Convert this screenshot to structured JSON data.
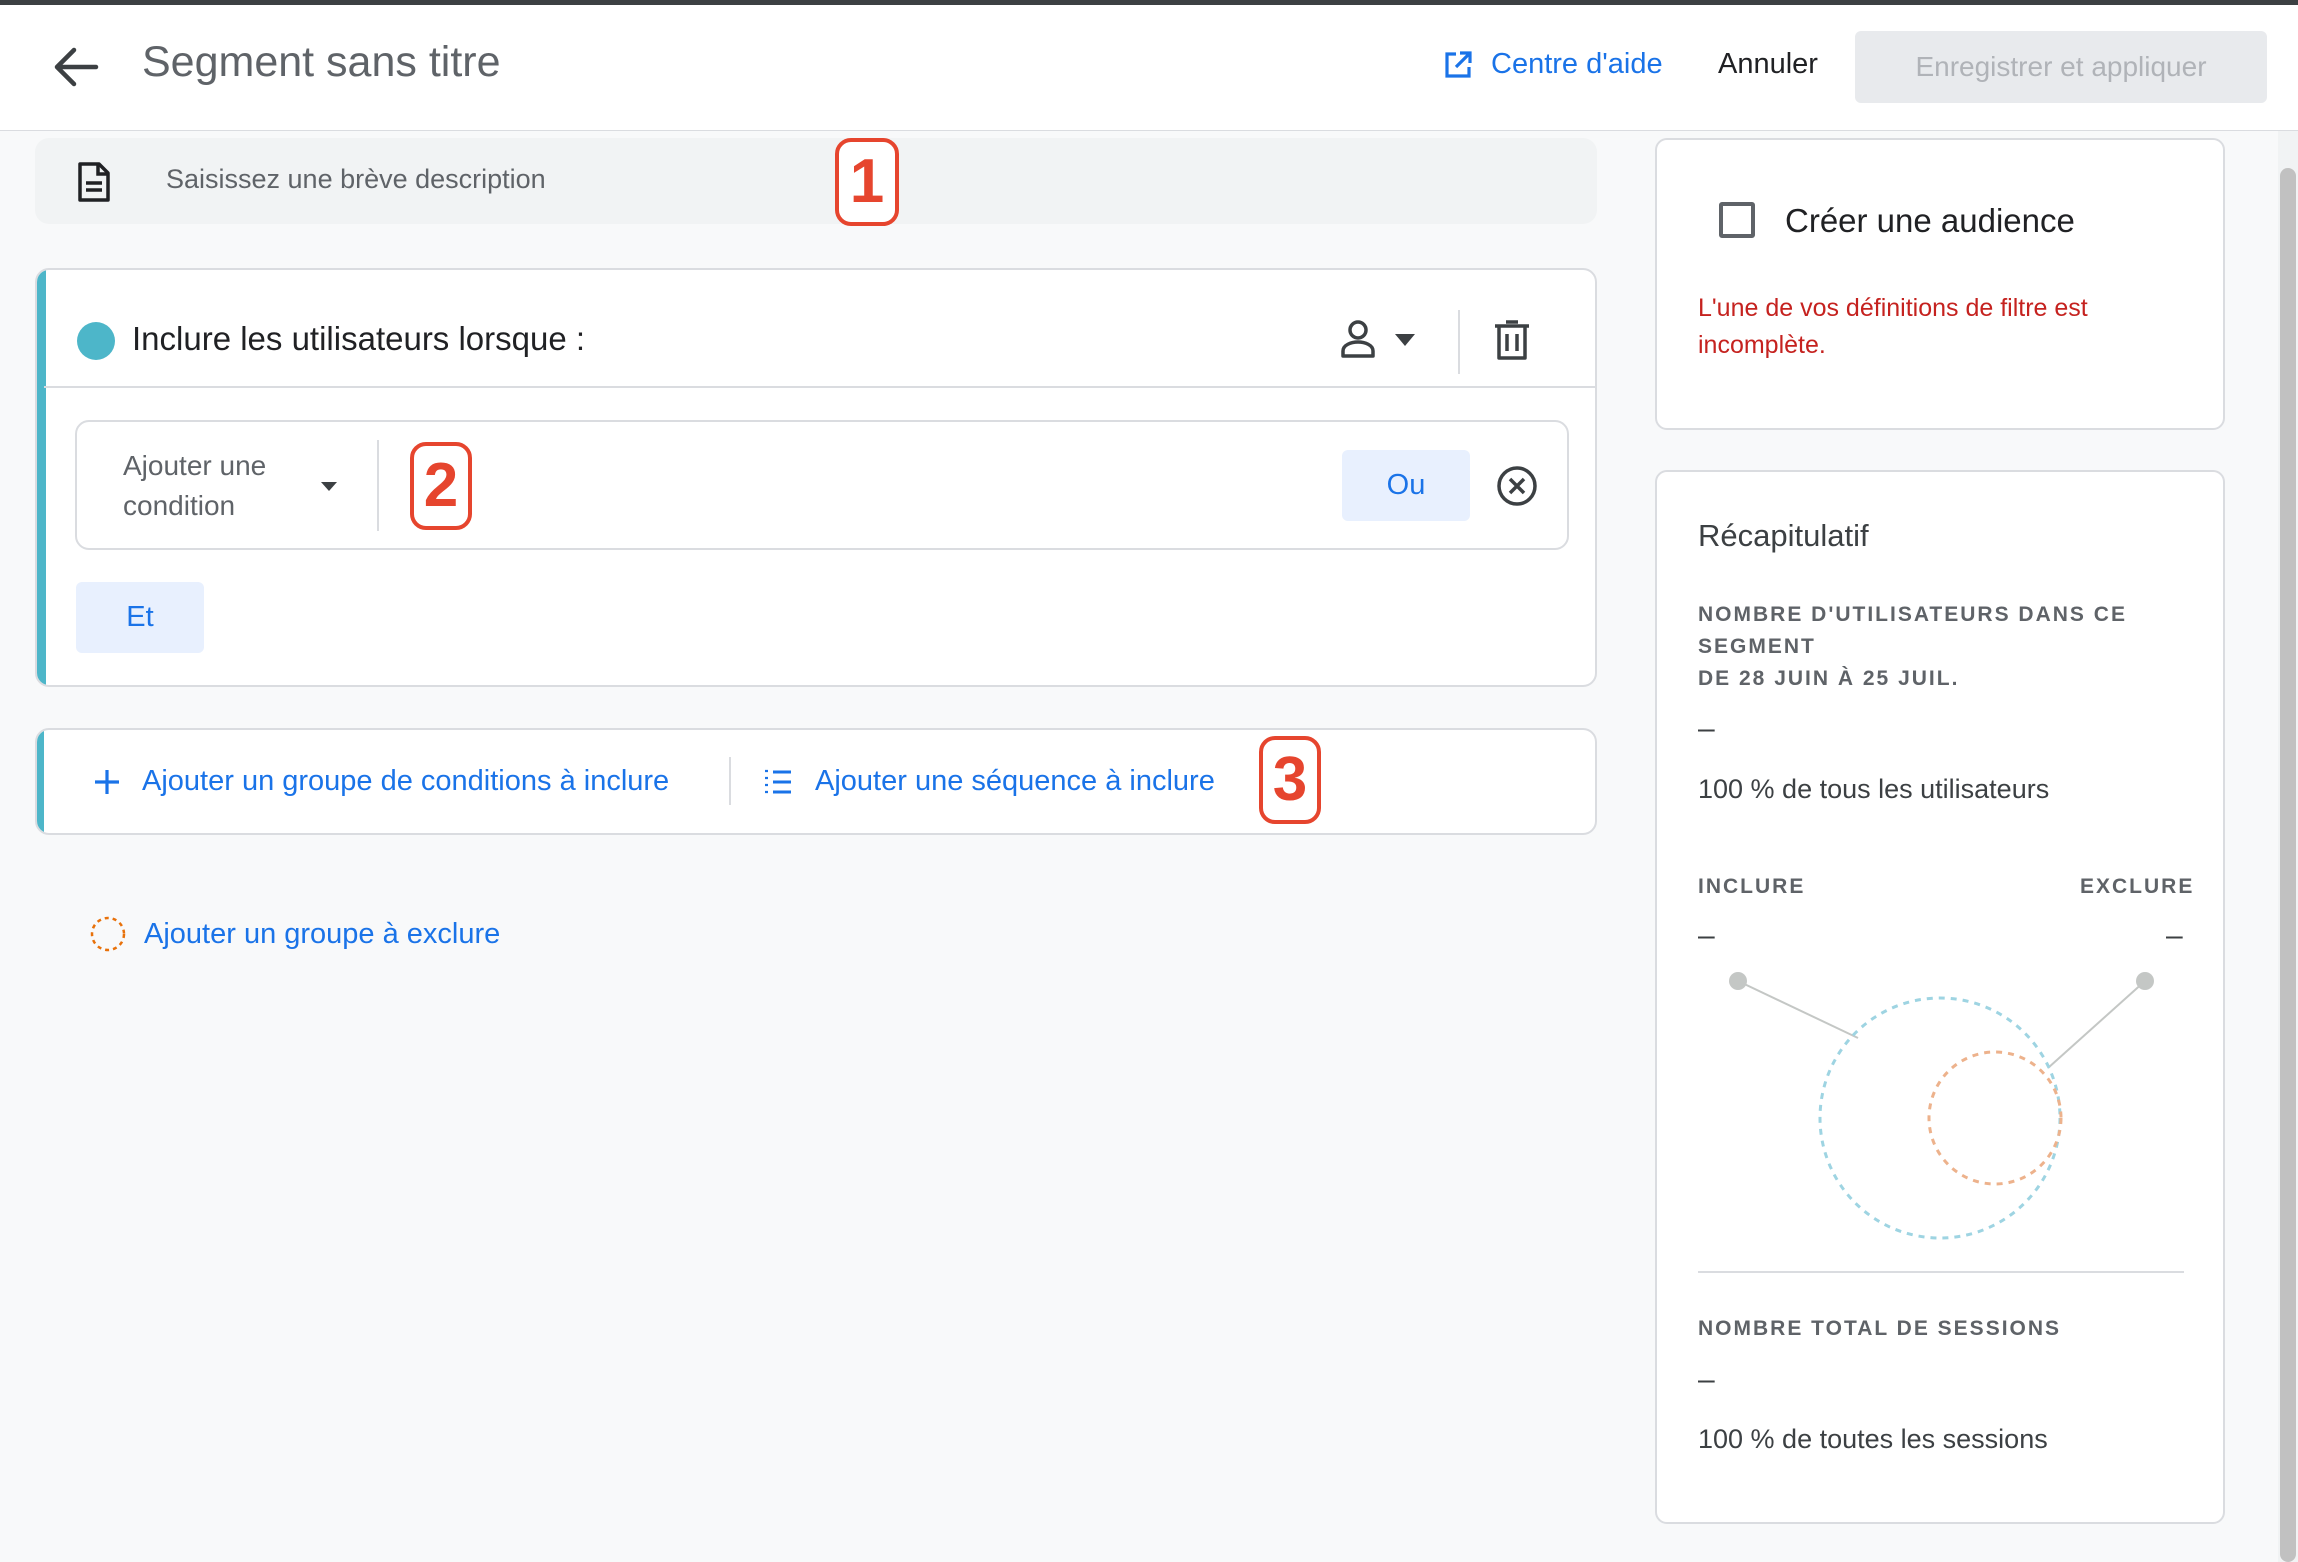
{
  "header": {
    "title": "Segment sans titre",
    "help_label": "Centre d'aide",
    "cancel_label": "Annuler",
    "save_label": "Enregistrer et appliquer"
  },
  "description": {
    "placeholder": "Saisissez une brève description"
  },
  "callouts": [
    "1",
    "2",
    "3"
  ],
  "include_group": {
    "title": "Inclure les utilisateurs lorsque :",
    "condition_placeholder_line1": "Ajouter une",
    "condition_placeholder_line2": "condition",
    "or_label": "Ou",
    "and_label": "Et"
  },
  "actions": {
    "add_condition_group": "Ajouter un groupe de conditions à inclure",
    "add_sequence": "Ajouter une séquence à inclure",
    "add_exclude_group": "Ajouter un groupe à exclure"
  },
  "audience": {
    "label": "Créer une audience",
    "error": "L'une de vos définitions de filtre est incomplète."
  },
  "summary": {
    "title": "Récapitulatif",
    "users_label_line1": "NOMBRE D'UTILISATEURS DANS CE",
    "users_label_line2": "SEGMENT",
    "users_label_line3": "DE 28 JUIN À 25 JUIL.",
    "users_value": "–",
    "users_pct": "100 % de tous les utilisateurs",
    "include_label": "INCLURE",
    "exclude_label": "EXCLURE",
    "include_value": "–",
    "exclude_value": "–",
    "sessions_label": "NOMBRE TOTAL DE SESSIONS",
    "sessions_value": "–",
    "sessions_pct": "100 % de toutes les sessions"
  },
  "colors": {
    "accent": "#1a73e8",
    "include": "#4db6c9",
    "exclude": "#e8a47b",
    "error": "#c5221f",
    "callout": "#e6452e"
  }
}
